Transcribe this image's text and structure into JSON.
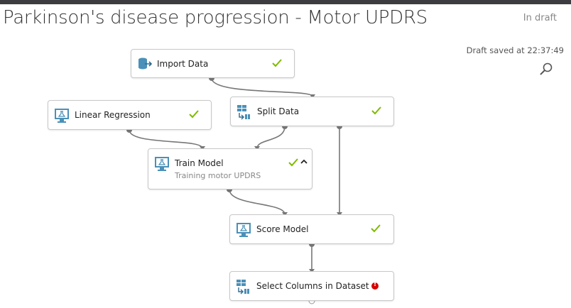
{
  "experiment": {
    "title": "Parkinson's disease progression - Motor UPDRS",
    "status": "In draft",
    "saved_text": "Draft saved at 22:37:49"
  },
  "modules": {
    "import_data": {
      "label": "Import Data",
      "icon": "import-data-icon",
      "state": "complete"
    },
    "linear_regression": {
      "label": "Linear Regression",
      "icon": "flask-monitor-icon",
      "state": "complete"
    },
    "split_data": {
      "label": "Split Data",
      "icon": "split-data-icon",
      "state": "complete"
    },
    "train_model": {
      "label": "Train Model",
      "subtitle": "Training motor UPDRS",
      "icon": "flask-monitor-icon",
      "state": "complete"
    },
    "score_model": {
      "label": "Score Model",
      "icon": "flask-monitor-icon",
      "state": "complete"
    },
    "select_columns": {
      "label": "Select Columns in Dataset",
      "icon": "table-columns-icon",
      "state": "error"
    }
  },
  "colors": {
    "check": "#7fba00",
    "error": "#d60000",
    "icon": "#4a90b8",
    "wire": "#777777"
  }
}
